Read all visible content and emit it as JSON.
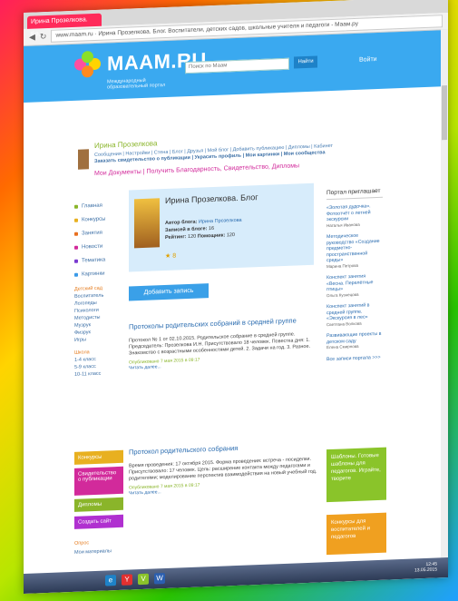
{
  "browser": {
    "tab_title": "Ирина Прозелкова. Бл...",
    "url": "www.maam.ru · Ирина Прозелкова. Блог. Воспитатели, детских садов, школьные учителя и педагоги - Маам.ру",
    "back": "◀",
    "reload": "↻"
  },
  "site": {
    "logo": "MAAM.RU",
    "tagline": "Международный образовательный портал",
    "search_placeholder": "Поиск по Маам",
    "search_button": "Найти",
    "login": "Войти"
  },
  "user": {
    "name": "Ирина Прозелкова",
    "links": "Сообщения | Настройки | Стена | Блог | Друзья | Мой блог | Добавить публикацию | Дипломы | Кабинет",
    "links2": "Заказать свидетельство о публикации | Украсить профиль | Мои картинки | Мои сообщества",
    "docs": "Мои Документы | Получить Благодарность, Свидетельство, Дипломы"
  },
  "left_nav": {
    "items": [
      {
        "label": "Главная",
        "color": "#8ab52a"
      },
      {
        "label": "Конкурсы",
        "color": "#e8b020"
      },
      {
        "label": "Занятия",
        "color": "#e87020"
      },
      {
        "label": "Новости",
        "color": "#d22a9b"
      },
      {
        "label": "Тематика",
        "color": "#7a3ad0"
      },
      {
        "label": "Картинки",
        "color": "#3a9ae8"
      }
    ],
    "section1_title": "Детский сад",
    "section1": [
      "Воспитатель",
      "Логопеды",
      "Психологи",
      "Методисты",
      "Музрук",
      "Физрук",
      "Игры"
    ],
    "section2_title": "Школа",
    "section2": [
      "1-4 класс",
      "5-9 класс",
      "10-11 класс"
    ],
    "buttons": [
      {
        "label": "Конкурсы",
        "color": "#e8b020"
      },
      {
        "label": "Свидетельство о публикации",
        "color": "#d22a9b"
      },
      {
        "label": "Дипломы",
        "color": "#8ab52a"
      },
      {
        "label": "Создать сайт",
        "color": "#b030d0"
      }
    ],
    "footer": [
      "Опрос",
      "Мои материалы"
    ]
  },
  "profile": {
    "title": "Ирина Прозелкова. Блог",
    "author_label": "Автор блога:",
    "author": "Ирина Прозелкова",
    "records_label": "Записей в блоге:",
    "records": "16",
    "rating_label": "Рейтинг:",
    "rating": "120",
    "subs_label": "Помощник:",
    "subs": "120",
    "likes": "8"
  },
  "add_entry_button": "Добавить запись",
  "posts": [
    {
      "title": "Протоколы родительских собраний в средней группе",
      "body": "Протокол № 1 от 02.10.2015. Родительское собрание в средней группе. Председатель: Прозелкова И.Н. Присутствовало 18 человек. Повестка дня: 1. Знакомство с возрастными особенностями детей. 2. Задачи на год. 3. Разное.",
      "meta": "Опубликовано 7 мая 2015 в 09:17",
      "more": "Читать далее..."
    },
    {
      "title": "Протокол родительского собрания",
      "body": "Время проведения: 17 октября 2015. Форма проведения: встреча - посиделки. Присутствовало: 17 человек. Цель: расширение контакта между педагогами и родителями; моделирование перспектив взаимодействия на новый учебный год.",
      "meta": "Опубликовано 7 мая 2015 в 09:17",
      "more": "Читать далее..."
    }
  ],
  "right_col": {
    "heading": "Портал приглашает",
    "items": [
      {
        "title": "«Золотая дудочка». Фотоотчёт о летней экскурсии",
        "author": "Наталья Иванова"
      },
      {
        "title": "Методическое руководство «Создание предметно-пространственной среды»",
        "author": "Марина Петрова"
      },
      {
        "title": "Конспект занятия «Весна. Перелётные птицы»",
        "author": "Ольга Кузнецова"
      },
      {
        "title": "Конспект занятий в средней группе. «Экскурсия в лес»",
        "author": "Светлана Волкова"
      },
      {
        "title": "Развивающие проекты в детском саду",
        "author": "Елена Смирнова"
      }
    ],
    "more": "Все записи портала >>>",
    "boxes": [
      {
        "label": "Шаблоны. Готовые шаблоны для педагогов. Играйте, творите",
        "color": "#8ac42a"
      },
      {
        "label": "Конкурсы для воспитателей и педагогов",
        "color": "#f0a020"
      }
    ]
  },
  "taskbar": {
    "time": "12:45",
    "date": "13.05.2015",
    "apps": [
      "e",
      "Y",
      "V",
      "W"
    ]
  }
}
